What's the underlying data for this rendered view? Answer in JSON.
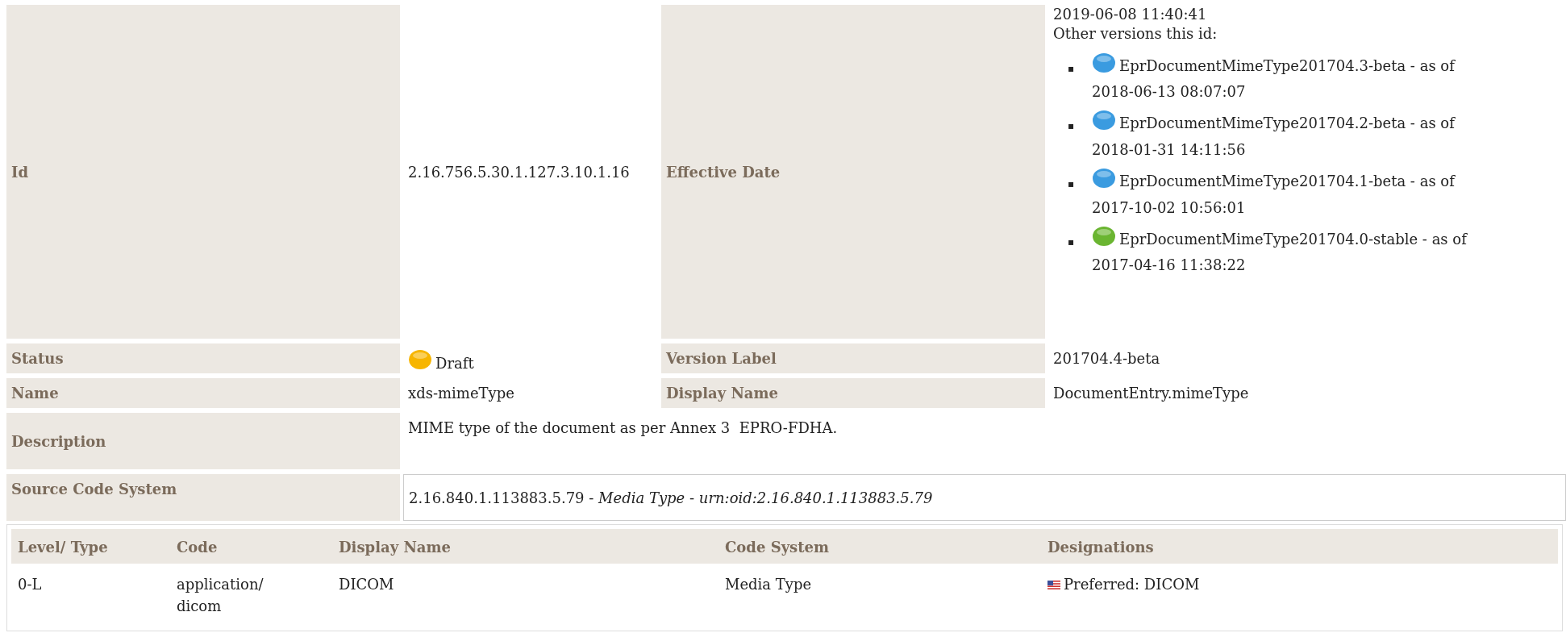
{
  "details": {
    "id": {
      "label": "Id",
      "value": "2.16.756.5.30.1.127.3.10.1.16"
    },
    "effective_date": {
      "label": "Effective Date",
      "value": "2019-06-08 11:40:41",
      "versions_heading": "Other versions this id:",
      "versions": [
        {
          "bullet": "▪",
          "color": "#3a9be0",
          "text": "EprDocumentMimeType201704.3-beta - as of",
          "date": "2018-06-13 08:07:07"
        },
        {
          "bullet": "▪",
          "color": "#3a9be0",
          "text": "EprDocumentMimeType201704.2-beta - as of",
          "date": "2018-01-31 14:11:56"
        },
        {
          "bullet": "▪",
          "color": "#3a9be0",
          "text": "EprDocumentMimeType201704.1-beta - as of",
          "date": "2017-10-02 10:56:01"
        },
        {
          "bullet": "▪",
          "color": "#6ab531",
          "text": "EprDocumentMimeType201704.0-stable - as of",
          "date": "2017-04-16 11:38:22"
        }
      ]
    },
    "status": {
      "label": "Status",
      "value": "Draft",
      "color": "#f7b500"
    },
    "version_label": {
      "label": "Version Label",
      "value": "201704.4-beta"
    },
    "name": {
      "label": "Name",
      "value": "xds-mimeType"
    },
    "display_name": {
      "label": "Display Name",
      "value": "DocumentEntry.mimeType"
    },
    "description": {
      "label": "Description",
      "value": "MIME type of the document as per Annex 3  EPRO-FDHA."
    },
    "source_code_system": {
      "label": "Source Code System",
      "value": "2.16.840.1.113883.5.79 - *Media Type* - *urn:oid:2.16.840.1.113883.5.79*"
    }
  },
  "table": {
    "columns": [
      "Level/ Type",
      "Code",
      "Display Name",
      "Code System",
      "Designations"
    ],
    "rows": [
      {
        "level_type": "0-L",
        "code": "application/dicom",
        "display_name": "DICOM",
        "code_system": "Media Type",
        "designation": "Preferred: DICOM"
      }
    ]
  }
}
